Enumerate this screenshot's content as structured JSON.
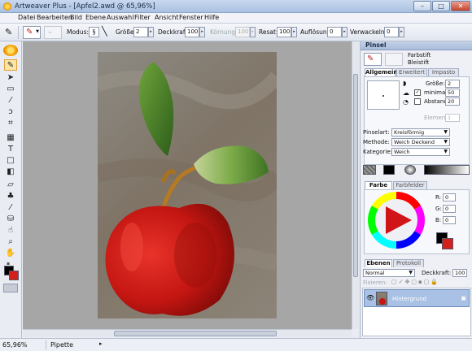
{
  "window": {
    "title": "Artweaver Plus - [Apfel2.awd @ 65,96%]",
    "minimize": "–",
    "maximize": "□",
    "close": "✕"
  },
  "menu": [
    "Datei",
    "Bearbeiten",
    "Bild",
    "Ebene",
    "Auswahl",
    "Filter",
    "Ansicht",
    "Fenster",
    "Hilfe"
  ],
  "options": {
    "modus_label": "Modus:",
    "groesse_label": "Größe:",
    "groesse_value": "2",
    "deckkraft_label": "Deckkraft:",
    "deckkraft_value": "100",
    "koernung_label": "Körnung:",
    "koernung_value": "100",
    "resat_label": "Resat:",
    "resat_value": "100",
    "aufloesung_label": "Auflösung:",
    "aufloesung_value": "0",
    "verwackeln_label": "Verwackeln:",
    "verwackeln_value": "0"
  },
  "brush_panel": {
    "title": "Pinsel",
    "category": "Farbstift",
    "variant": "Bleistift",
    "tabs": [
      "Allgemein",
      "Erweitert",
      "Impasto"
    ],
    "groesse_label": "Größe:",
    "groesse_value": "2",
    "minimal_label": "minimal:",
    "minimal_value": "50",
    "abstand_label": "Abstand:",
    "abstand_value": "20",
    "element_label": "Element:",
    "element_value": "1",
    "pinselart_label": "Pinselart:",
    "pinselart_value": "Kreisförmig",
    "methode_label": "Methode:",
    "methode_value": "Weich Deckend",
    "kategorie_label": "Kategorie:",
    "kategorie_value": "Weich"
  },
  "color_panel": {
    "tabs": [
      "Farbe",
      "Farbfelder"
    ],
    "r_label": "R:",
    "r_value": "0",
    "g_label": "G:",
    "g_value": "0",
    "b_label": "B:",
    "b_value": "0",
    "foreground": "#000000",
    "background": "#d4201c"
  },
  "layers_panel": {
    "tabs": [
      "Ebenen",
      "Protokoll"
    ],
    "blend_mode": "Normal",
    "deckkraft_label": "Deckkraft:",
    "deckkraft_value": "100",
    "fixieren_label": "Fixieren:",
    "layer_name": "Hintergrund"
  },
  "status": {
    "zoom": "65,96%",
    "tool": "Pipette"
  },
  "colors": {
    "accent": "#f0a000",
    "canvas_bg": "#a6a6a6",
    "apple_red": "#d4201c",
    "leaf_green": "#4f8a2a"
  }
}
